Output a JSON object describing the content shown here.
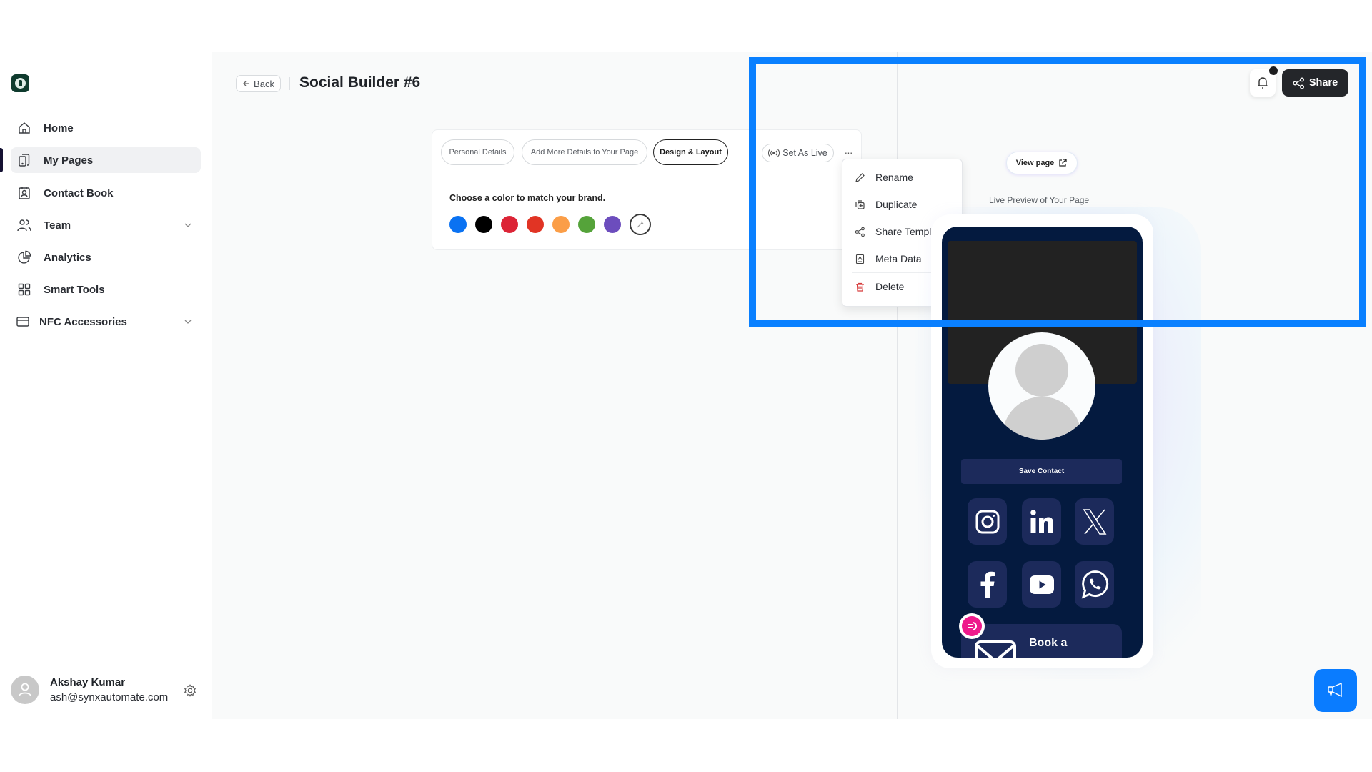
{
  "sidebar": {
    "logo": "brand-logo",
    "items": [
      {
        "label": "Home",
        "icon": "home-icon",
        "active": false
      },
      {
        "label": "My Pages",
        "icon": "pages-icon",
        "active": true
      },
      {
        "label": "Contact Book",
        "icon": "contact-book-icon",
        "active": false
      },
      {
        "label": "Team",
        "icon": "team-icon",
        "active": false,
        "expandable": true
      },
      {
        "label": "Analytics",
        "icon": "analytics-icon",
        "active": false
      },
      {
        "label": "Smart Tools",
        "icon": "grid-icon",
        "active": false
      },
      {
        "label": "NFC Accessories",
        "icon": "card-icon",
        "active": false,
        "expandable": true
      }
    ],
    "user": {
      "name": "Akshay Kumar",
      "email": "ash@synxautomate.com"
    }
  },
  "header": {
    "back_label": "Back",
    "title": "Social Builder #6",
    "share_label": "Share",
    "notification_dot": true
  },
  "editor": {
    "tabs": [
      {
        "label": "Personal Details",
        "active": false
      },
      {
        "label": "Add More Details to Your Page",
        "active": false
      },
      {
        "label": "Design & Layout",
        "active": true
      }
    ],
    "set_live_label": "Set As Live",
    "more_label": "···",
    "color_prompt": "Choose a color to match your brand.",
    "colors": [
      "#0a72f2",
      "#000000",
      "#dc2436",
      "#e13424",
      "#fb9e48",
      "#55a33a",
      "#6c4dbd"
    ],
    "custom_color_picker": "eyedropper-icon"
  },
  "menu": {
    "items": [
      {
        "label": "Rename",
        "icon": "pencil-icon"
      },
      {
        "label": "Duplicate",
        "icon": "duplicate-icon"
      },
      {
        "label": "Share Template",
        "icon": "share-icon"
      },
      {
        "label": "Meta Data",
        "icon": "meta-data-icon"
      },
      {
        "label": "Delete",
        "icon": "trash-icon",
        "danger": true
      }
    ]
  },
  "preview": {
    "view_page_label": "View page",
    "label": "Live Preview of Your Page",
    "save_contact_label": "Save Contact",
    "socials": [
      "Instagram",
      "LinkedIn",
      "X",
      "Facebook",
      "YouTube",
      "WhatsApp"
    ],
    "book_label": "Book a",
    "theme_color": "#041a3f",
    "accent_color": "#1c2a5b"
  },
  "colors": {
    "highlight": "#0a80ff",
    "primary_button": "#24262a",
    "announce_button": "#0a7cff"
  }
}
